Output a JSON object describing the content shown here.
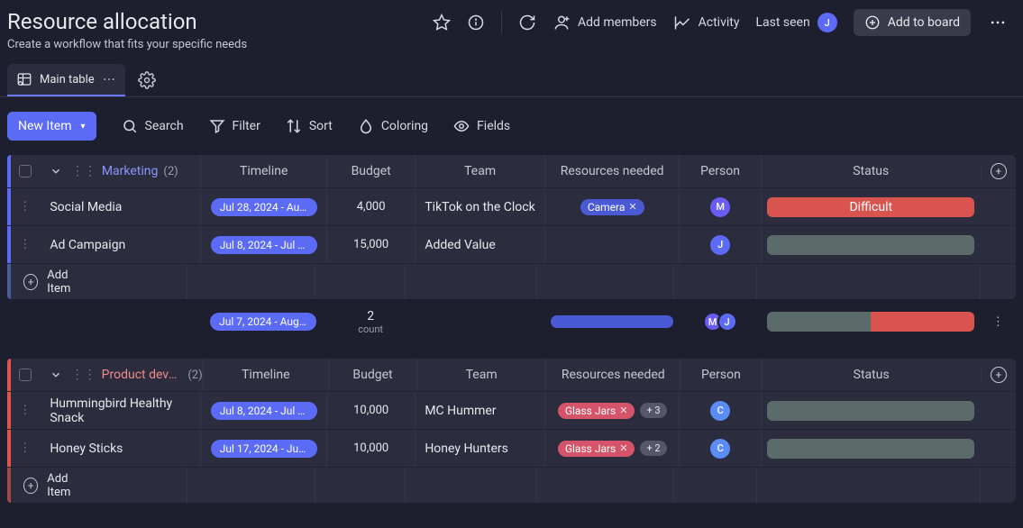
{
  "header": {
    "title": "Resource allocation",
    "subtitle": "Create a workflow that fits your specific needs",
    "add_members": "Add members",
    "activity": "Activity",
    "last_seen": "Last seen",
    "last_seen_avatar": "J",
    "add_to_board": "Add to board"
  },
  "view": {
    "main_table": "Main table"
  },
  "toolbar": {
    "new_item": "New Item",
    "search": "Search",
    "filter": "Filter",
    "sort": "Sort",
    "coloring": "Coloring",
    "fields": "Fields"
  },
  "columns": {
    "timeline": "Timeline",
    "budget": "Budget",
    "team": "Team",
    "resources": "Resources needed",
    "person": "Person",
    "status": "Status"
  },
  "groups": [
    {
      "name": "Marketing",
      "count": "(2)",
      "color": "blue",
      "rows": [
        {
          "name": "Social Media",
          "timeline": "Jul 28, 2024 - Aug…",
          "budget": "4,000",
          "team": "TikTok on the Clock",
          "resources": [
            {
              "label": "Camera",
              "type": "blue",
              "removable": true
            }
          ],
          "person": "M",
          "status": {
            "label": "Difficult",
            "type": "red"
          }
        },
        {
          "name": "Ad Campaign",
          "timeline": "Jul 8, 2024 - Jul 2…",
          "budget": "15,000",
          "team": "Added Value",
          "resources": [],
          "person": "J",
          "status": {
            "label": "",
            "type": "grey"
          }
        }
      ],
      "add_item": "Add Item",
      "summary": {
        "timeline": "Jul 7, 2024 - Aug …",
        "count_num": "2",
        "count_lbl": "count",
        "persons": [
          "M",
          "J"
        ]
      }
    },
    {
      "name": "Product devel…",
      "count": "(2)",
      "color": "red",
      "rows": [
        {
          "name": "Hummingbird Healthy Snack",
          "timeline": "Jul 8, 2024 - Jul 1…",
          "budget": "10,000",
          "team": "MC Hummer",
          "resources": [
            {
              "label": "Glass Jars",
              "type": "red",
              "removable": true
            }
          ],
          "extra": "+ 3",
          "person": "C",
          "status": {
            "label": "",
            "type": "grey"
          }
        },
        {
          "name": "Honey Sticks",
          "timeline": "Jul 17, 2024 - Jul …",
          "budget": "10,000",
          "team": "Honey Hunters",
          "resources": [
            {
              "label": "Glass Jars",
              "type": "red",
              "removable": true
            }
          ],
          "extra": "+ 2",
          "person": "C",
          "status": {
            "label": "",
            "type": "grey"
          }
        }
      ],
      "add_item": "Add Item"
    }
  ]
}
